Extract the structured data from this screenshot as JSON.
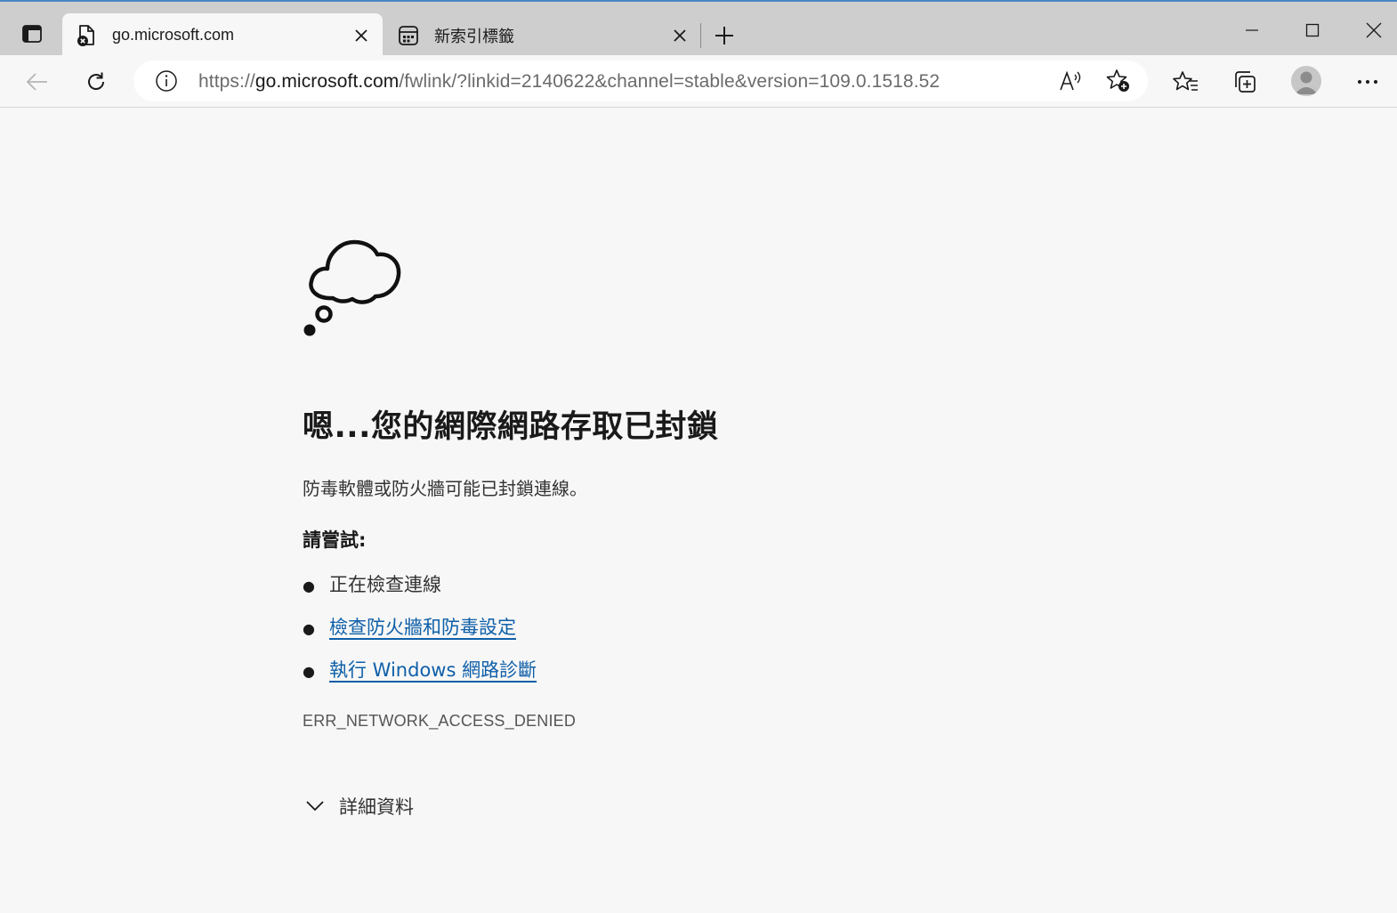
{
  "tabs": [
    {
      "title": "go.microsoft.com",
      "icon": "error-page-icon",
      "active": true
    },
    {
      "title": "新索引標籤",
      "icon": "new-tab-page-icon",
      "active": false
    }
  ],
  "address_bar": {
    "url_prefix": "https://",
    "url_host": "go.microsoft.com",
    "url_path": "/fwlink/?linkid=2140622&channel=stable&version=109.0.1518.52"
  },
  "error_page": {
    "title": "嗯...您的網際網路存取已封鎖",
    "description": "防毒軟體或防火牆可能已封鎖連線。",
    "try_label": "請嘗試:",
    "suggestions": [
      {
        "text": "正在檢查連線",
        "is_link": false
      },
      {
        "text": "檢查防火牆和防毒設定",
        "is_link": true
      },
      {
        "text": "執行 Windows 網路診斷",
        "is_link": true
      }
    ],
    "error_code": "ERR_NETWORK_ACCESS_DENIED",
    "details_label": "詳細資料"
  },
  "colors": {
    "link": "#0f5fa8",
    "tabstrip_bg": "#cecece",
    "page_bg": "#f7f7f7"
  }
}
